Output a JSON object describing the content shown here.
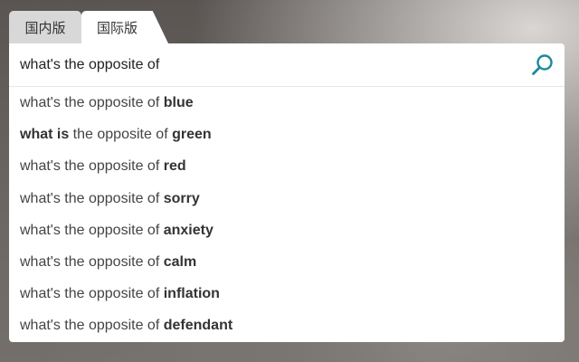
{
  "tabs": {
    "domestic": "国内版",
    "international": "国际版"
  },
  "search": {
    "value": "what's the opposite of",
    "icon": "search-icon",
    "accent_color": "#1a8a9a"
  },
  "suggestions": [
    {
      "prefix": "what's the opposite of ",
      "bold_lead": "",
      "middle": "",
      "bold": "blue"
    },
    {
      "prefix": "",
      "bold_lead": "what is",
      "middle": " the opposite of ",
      "bold": "green"
    },
    {
      "prefix": "what's the opposite of ",
      "bold_lead": "",
      "middle": "",
      "bold": "red"
    },
    {
      "prefix": "what's the opposite of ",
      "bold_lead": "",
      "middle": "",
      "bold": "sorry"
    },
    {
      "prefix": "what's the opposite of ",
      "bold_lead": "",
      "middle": "",
      "bold": "anxiety"
    },
    {
      "prefix": "what's the opposite of ",
      "bold_lead": "",
      "middle": "",
      "bold": "calm"
    },
    {
      "prefix": "what's the opposite of ",
      "bold_lead": "",
      "middle": "",
      "bold": "inflation"
    },
    {
      "prefix": "what's the opposite of ",
      "bold_lead": "",
      "middle": "",
      "bold": "defendant"
    }
  ]
}
